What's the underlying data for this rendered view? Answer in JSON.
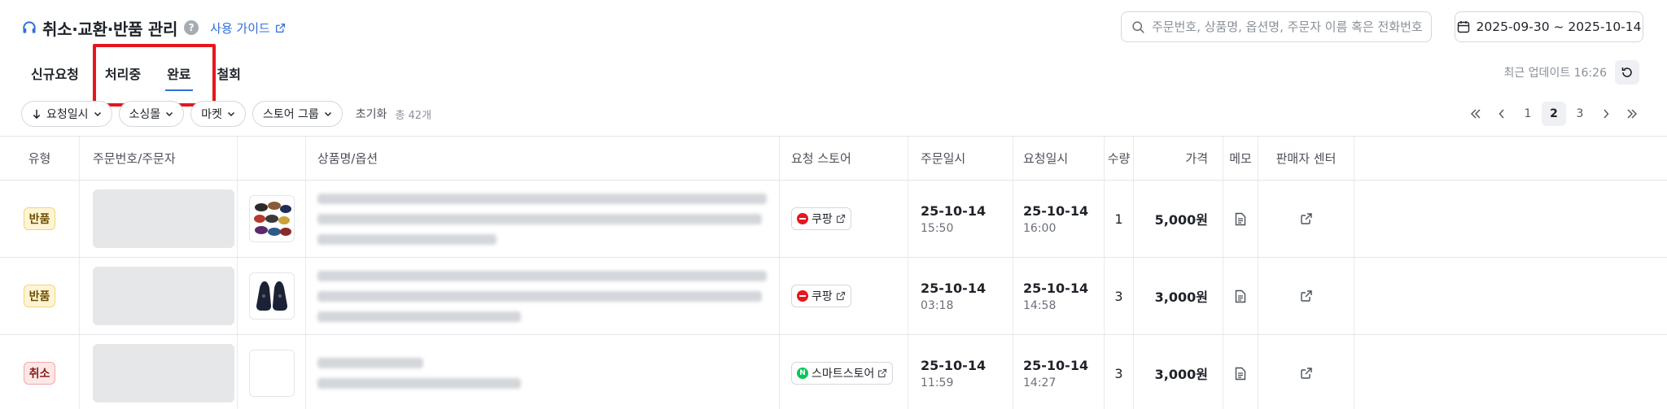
{
  "header": {
    "title": "취소·교환·반품 관리",
    "help_label": "?",
    "guide_label": "사용 가이드",
    "search_placeholder": "주문번호, 상품명, 옵션명, 주문자 이름 혹은 전화번호",
    "date_range": "2025-09-30 ~ 2025-10-14"
  },
  "tabs": [
    {
      "label": "신규요청",
      "active": false
    },
    {
      "label": "처리중",
      "active": false
    },
    {
      "label": "완료",
      "active": true
    },
    {
      "label": "철회",
      "active": false
    }
  ],
  "update": {
    "label": "최근 업데이트 16:26"
  },
  "filters": {
    "sort_label": "요청일시",
    "chips": [
      "소싱몰",
      "마켓",
      "스토어 그룹"
    ],
    "reset_label": "초기화",
    "total_label": "총 42개"
  },
  "pagination": {
    "pages": [
      "1",
      "2",
      "3"
    ],
    "current": "2"
  },
  "table": {
    "headers": {
      "type": "유형",
      "order": "주문번호/주문자",
      "product": "상품명/옵션",
      "store": "요청 스토어",
      "order_date": "주문일시",
      "request_date": "요청일시",
      "qty": "수량",
      "price": "가격",
      "memo": "메모",
      "seller": "판매자 센터"
    },
    "rows": [
      {
        "type": "반품",
        "store": "쿠팡",
        "store_kind": "coupang",
        "order_date": "25-10-14",
        "order_time": "15:50",
        "request_date": "25-10-14",
        "request_time": "16:00",
        "qty": "1",
        "price": "5,000원"
      },
      {
        "type": "반품",
        "store": "쿠팡",
        "store_kind": "coupang",
        "order_date": "25-10-14",
        "order_time": "03:18",
        "request_date": "25-10-14",
        "request_time": "14:58",
        "qty": "3",
        "price": "3,000원"
      },
      {
        "type": "취소",
        "store": "스마트스토어",
        "store_kind": "naver",
        "order_date": "25-10-14",
        "order_time": "11:59",
        "request_date": "25-10-14",
        "request_time": "14:27",
        "qty": "3",
        "price": "3,000원"
      }
    ]
  },
  "colors": {
    "accent": "#2f6fdb",
    "highlight": "#e5161e",
    "coupang": "#e5161e",
    "naver": "#03c75a"
  }
}
